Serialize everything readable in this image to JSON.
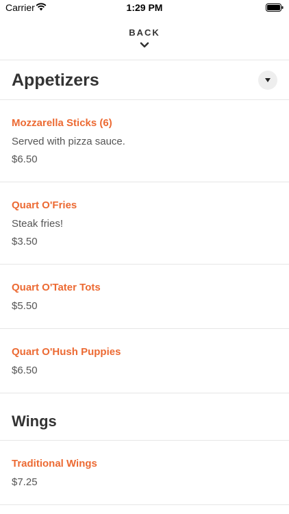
{
  "status_bar": {
    "carrier": "Carrier",
    "time": "1:29 PM"
  },
  "nav": {
    "back_label": "BACK"
  },
  "sections": [
    {
      "title": "Appetizers",
      "items": [
        {
          "name": "Mozzarella Sticks (6)",
          "description": "Served with pizza sauce.",
          "price": "$6.50"
        },
        {
          "name": "Quart O'Fries",
          "description": "Steak fries!",
          "price": "$3.50"
        },
        {
          "name": "Quart O'Tater Tots",
          "price": "$5.50"
        },
        {
          "name": "Quart O'Hush Puppies",
          "price": "$6.50"
        }
      ]
    },
    {
      "title": "Wings",
      "items": [
        {
          "name": "Traditional Wings",
          "price": "$7.25"
        }
      ]
    }
  ],
  "colors": {
    "accent": "#ec6a33",
    "divider": "#e6e6e6",
    "text": "#333333"
  },
  "icons": {
    "collapse": "triangle-down-icon",
    "back": "chevron-down-icon"
  }
}
